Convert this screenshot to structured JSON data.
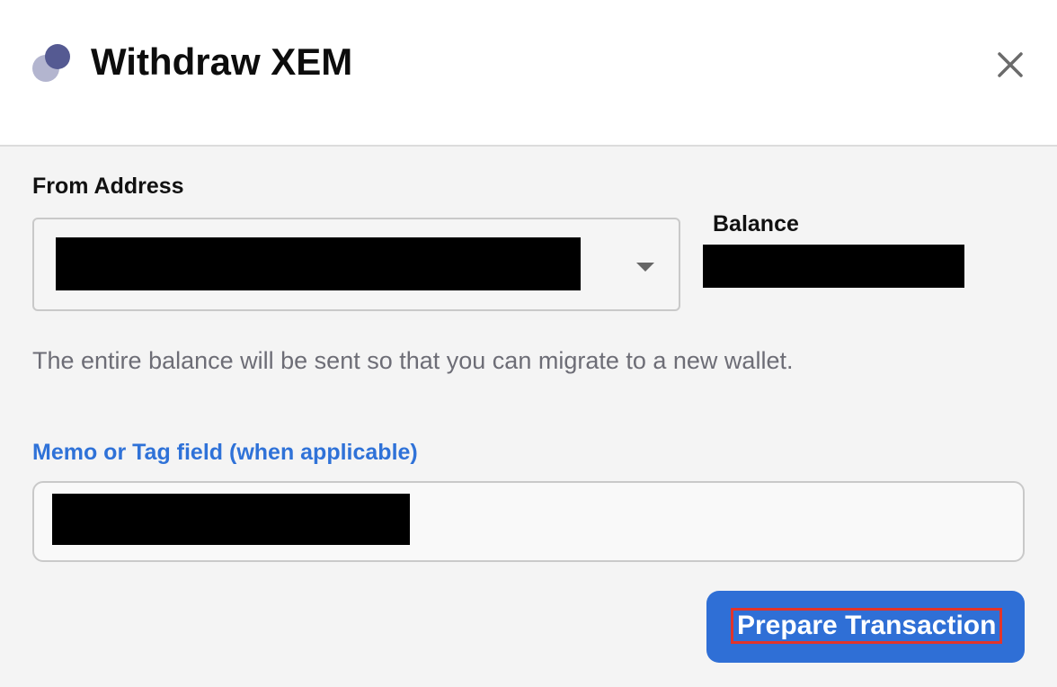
{
  "dialog": {
    "title": "Withdraw XEM",
    "logo_icon": "xem-logo-icon",
    "close_icon": "close-icon"
  },
  "from_address": {
    "label": "From Address",
    "selected_value": "[redacted]",
    "dropdown_icon": "caret-down-icon"
  },
  "balance": {
    "label": "Balance",
    "value": "[redacted]"
  },
  "helper_text": "The entire balance will be sent so that you can migrate to a new wallet.",
  "memo": {
    "label": "Memo or Tag field (when applicable)",
    "value": "[redacted]"
  },
  "actions": {
    "prepare_label": "Prepare Transaction"
  },
  "colors": {
    "accent": "#2f6fd6",
    "memo_label": "#2f72d8",
    "highlight_outline": "#e2342a",
    "logo_front": "#555a92",
    "logo_back": "#b3b5cf"
  }
}
